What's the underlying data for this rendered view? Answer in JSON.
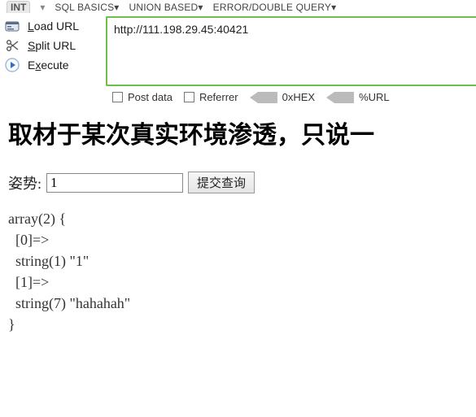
{
  "topbar": {
    "tab": "INT",
    "menus": [
      "SQL BASICS",
      "UNION BASED",
      "ERROR/DOUBLE QUERY"
    ]
  },
  "sideActions": {
    "load": {
      "pre": "",
      "hot": "L",
      "post": "oad URL"
    },
    "split": {
      "pre": "",
      "hot": "S",
      "post": "plit URL"
    },
    "exec": {
      "pre": "E",
      "hot": "x",
      "post": "ecute"
    }
  },
  "urlBox": {
    "value": "http://111.198.29.45:40421"
  },
  "options": {
    "postData": "Post data",
    "referrer": "Referrer",
    "hex": "0xHEX",
    "urlenc": "%URL"
  },
  "page": {
    "heading": "取材于某次真实环境渗透，只说一",
    "formLabel": "姿势:",
    "inputValue": "1",
    "submitLabel": "提交查询",
    "dump": "array(2) {\n  [0]=>\n  string(1) \"1\"\n  [1]=>\n  string(7) \"hahahah\"\n}"
  }
}
